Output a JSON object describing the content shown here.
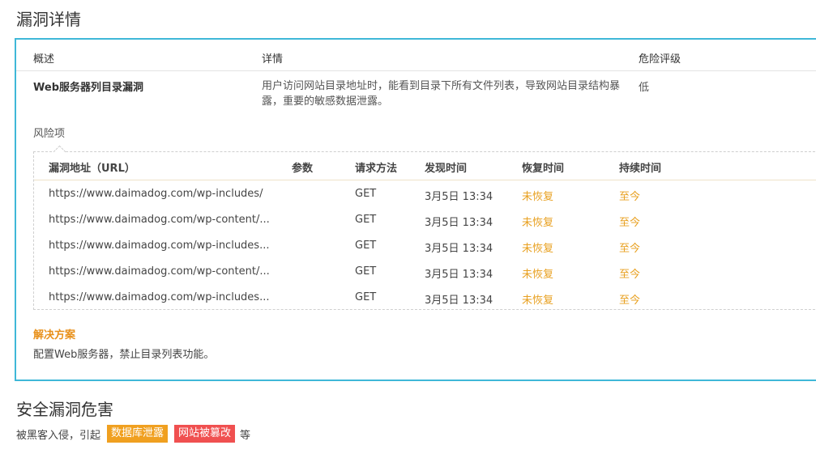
{
  "section1_title": "漏洞详情",
  "section2_title": "安全漏洞危害",
  "header": {
    "overview": "概述",
    "detail": "详情",
    "level": "危险评级"
  },
  "vuln": {
    "name": "Web服务器列目录漏洞",
    "detail": "用户访问网站目录地址时，能看到目录下所有文件列表，导致网站目录结构暴露，重要的敏感数据泄露。",
    "level": "低"
  },
  "risk_label": "风险项",
  "risk_table": {
    "columns": [
      "漏洞地址（URL）",
      "参数",
      "请求方法",
      "发现时间",
      "恢复时间",
      "持续时间"
    ],
    "rows": [
      {
        "url": "https://www.daimadog.com/wp-includes/",
        "param": "",
        "method": "GET",
        "found": "3月5日 13:34",
        "recover": "未恢复",
        "duration": "至今"
      },
      {
        "url": "https://www.daimadog.com/wp-content/...",
        "param": "",
        "method": "GET",
        "found": "3月5日 13:34",
        "recover": "未恢复",
        "duration": "至今"
      },
      {
        "url": "https://www.daimadog.com/wp-includes...",
        "param": "",
        "method": "GET",
        "found": "3月5日 13:34",
        "recover": "未恢复",
        "duration": "至今"
      },
      {
        "url": "https://www.daimadog.com/wp-content/...",
        "param": "",
        "method": "GET",
        "found": "3月5日 13:34",
        "recover": "未恢复",
        "duration": "至今"
      },
      {
        "url": "https://www.daimadog.com/wp-includes...",
        "param": "",
        "method": "GET",
        "found": "3月5日 13:34",
        "recover": "未恢复",
        "duration": "至今"
      }
    ]
  },
  "solution": {
    "title": "解决方案",
    "text": "配置Web服务器，禁止目录列表功能。"
  },
  "harm": {
    "prefix": "被黑客入侵，引起",
    "tags": [
      "数据库泄露",
      "网站被篡改"
    ],
    "suffix": "等"
  },
  "colors": {
    "border": "#3fb8d8",
    "accent": "#e8a020",
    "tag_orange": "#f0a020",
    "tag_red": "#f05050"
  }
}
